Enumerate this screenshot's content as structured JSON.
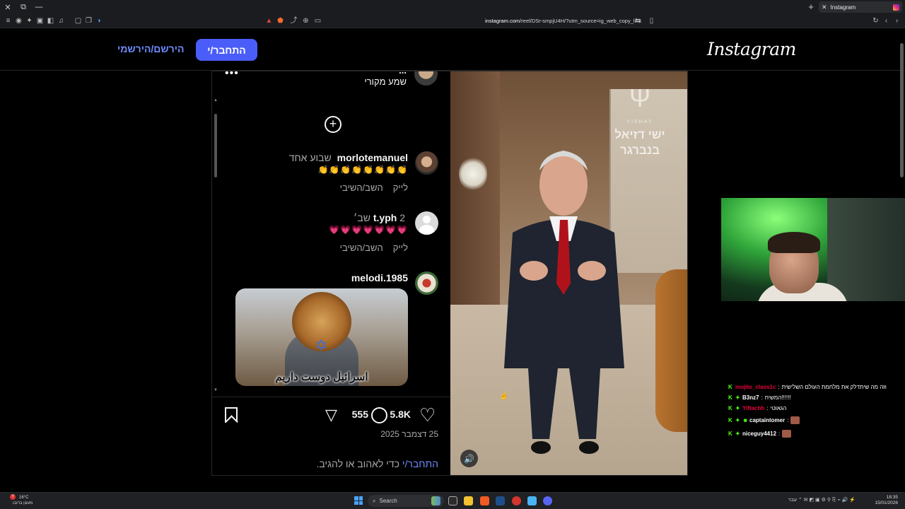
{
  "browser": {
    "tab_title": "Instagram",
    "url_host": "instagram.com",
    "url_path": "/reel/DSr-smpjU4H/?utm_source=ig_web_copy_link"
  },
  "header": {
    "logo": "Instagram",
    "login_label": "התחבר/י",
    "signup_label": "הירשם/הירשמי"
  },
  "post": {
    "author": {
      "name": "...",
      "follow_label": "",
      "audio_label": "שמע מקורי"
    },
    "comments": [
      {
        "user": "morlotemanuel",
        "time": "שבוע אחד",
        "body": "👏👏👏👏👏👏👏👏",
        "like_label": "לייק",
        "reply_label": "השב/השיבי"
      },
      {
        "user": "t.yph",
        "time": "2 שב׳",
        "body": "💗💗💗💗💗💗💗",
        "like_label": "לייק",
        "reply_label": "השב/השיבי"
      },
      {
        "user": "melodi.1985",
        "time": "",
        "image_caption": "اسرائيل دوست داريم"
      }
    ],
    "likes": "5.8K",
    "comment_count": "555",
    "date": "25 דצמבר 2025",
    "login_prompt_link": "התחבר/י",
    "login_prompt_text": " כדי לאהוב או להגיב."
  },
  "video": {
    "watermark_brand": "YISHAY",
    "watermark_text_1": "ישי דזיאל",
    "watermark_text_2": "בנברגר"
  },
  "chat": {
    "lines": [
      {
        "user": "mojito_class1c",
        "user_color": "#e8003c",
        "msg": "וזה מה שיתדלק את מלחמת העולם השלישית",
        "emote": false
      },
      {
        "user": "B3nz7",
        "user_color": "#ffffff",
        "msg": "המשיח!!!!!!",
        "emote": false
      },
      {
        "user": "Yiftachh",
        "user_color": "#e8003c",
        "msg": "הגאוטי",
        "emote": false
      },
      {
        "user": "captaintomer",
        "user_color": "#ffffff",
        "msg": "",
        "emote": true
      },
      {
        "user": "niceguy4412",
        "user_color": "#ffffff",
        "msg": "",
        "emote": true
      }
    ]
  },
  "taskbar": {
    "search_label": "Search",
    "weather_temp": "16°C",
    "weather_desc": "מעונן ברובו",
    "time": "18:35",
    "date": "15/01/2026",
    "tray_lang": "עבר"
  },
  "colors": {
    "ig_blue": "#4a5df9",
    "link_blue": "#6f8cff",
    "kick_green": "#53fc18"
  }
}
